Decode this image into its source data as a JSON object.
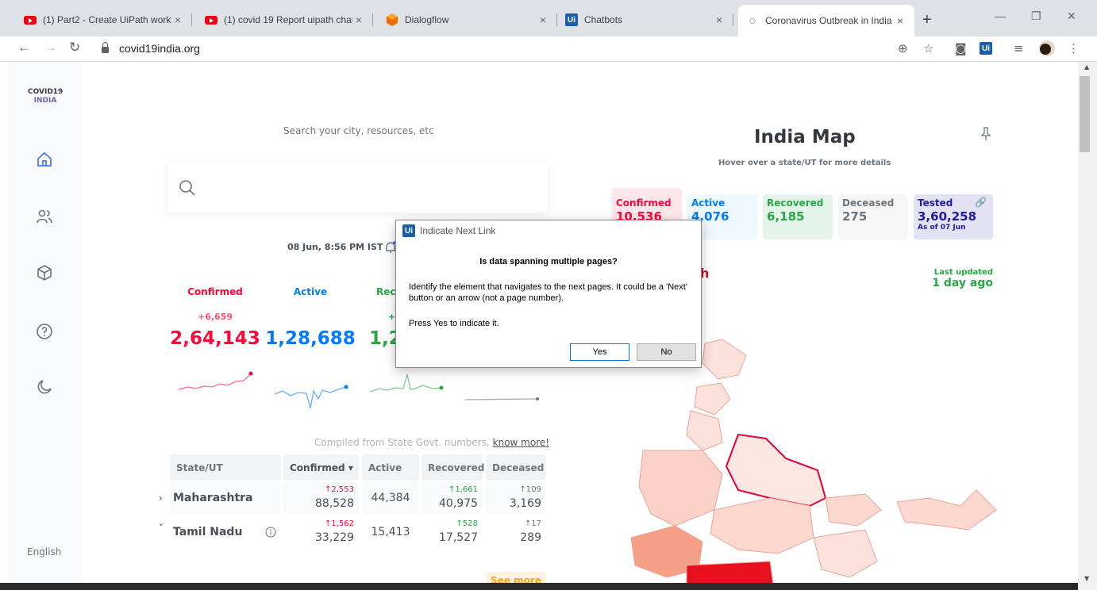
{
  "browser": {
    "tabs": [
      {
        "title": "(1) Part2 - Create UiPath workf",
        "favicon": "youtube-icon"
      },
      {
        "title": "(1) covid 19 Report uipath chat",
        "favicon": "youtube-icon"
      },
      {
        "title": "Dialogflow",
        "favicon": "dialogflow-icon"
      },
      {
        "title": "Chatbots",
        "favicon": "uipath-icon"
      },
      {
        "title": "Coronavirus Outbreak in India",
        "favicon": "loading-icon"
      }
    ],
    "url": "covid19india.org",
    "ui_badge": "Ui"
  },
  "sidebar": {
    "brand_line1": "COVID19",
    "brand_line2": "INDIA",
    "language": "English"
  },
  "search": {
    "label": "Search your city, resources, etc"
  },
  "updated_time": "08 Jun, 8:56 PM IST",
  "stats": [
    {
      "label": "Confirmed",
      "delta": "+6,659",
      "value": "2,64,143",
      "color": "#ff073a"
    },
    {
      "label": "Active",
      "delta": "",
      "value": "1,28,688",
      "color": "#007bff"
    },
    {
      "label": "Rec",
      "delta": "+",
      "value": "1,2",
      "color": "#28a745"
    }
  ],
  "table": {
    "compiled_text": "Compiled from State Govt. numbers,",
    "compiled_link": "know more!",
    "headers": [
      "State/UT",
      "Confirmed ▾",
      "Active",
      "Recovered",
      "Deceased"
    ],
    "rows": [
      {
        "expand": "›",
        "state": "Maharashtra",
        "confirmed_delta": "↑2,553",
        "confirmed": "88,528",
        "active": "44,384",
        "recovered_delta": "↑1,661",
        "recovered": "40,975",
        "deceased_delta": "↑109",
        "deceased": "3,169"
      },
      {
        "expand": "˅",
        "state": "Tamil Nadu",
        "confirmed_delta": "↑1,562",
        "confirmed": "33,229",
        "active": "15,413",
        "recovered_delta": "↑528",
        "recovered": "17,527",
        "deceased_delta": "↑17",
        "deceased": "289"
      }
    ],
    "see_more": "See more"
  },
  "map": {
    "title": "India Map",
    "subtitle": "Hover over a state/UT for more details",
    "boxes": [
      {
        "label": "Confirmed",
        "value": "10,536",
        "sub": ""
      },
      {
        "label": "Active",
        "value": "4,076",
        "sub": ""
      },
      {
        "label": "Recovered",
        "value": "6,185",
        "sub": ""
      },
      {
        "label": "Deceased",
        "value": "275",
        "sub": ""
      },
      {
        "label": "Tested",
        "value": "3,60,258",
        "sub": "As of 07 Jun"
      }
    ],
    "region_fragment": "h",
    "last_updated_label": "Last updated",
    "last_updated_value": "1 day ago"
  },
  "dialog": {
    "title": "Indicate Next Link",
    "question": "Is data spanning multiple pages?",
    "body": "Identify the element that navigates to the next pages. It could be a 'Next' button or an arrow (not a page number).",
    "press": "Press Yes to indicate it.",
    "yes": "Yes",
    "no": "No"
  },
  "colors": {
    "confirmed": "#ff073a",
    "active": "#007bff",
    "recovered": "#28a745",
    "deceased": "#6c757d",
    "tested": "#201aa2"
  }
}
